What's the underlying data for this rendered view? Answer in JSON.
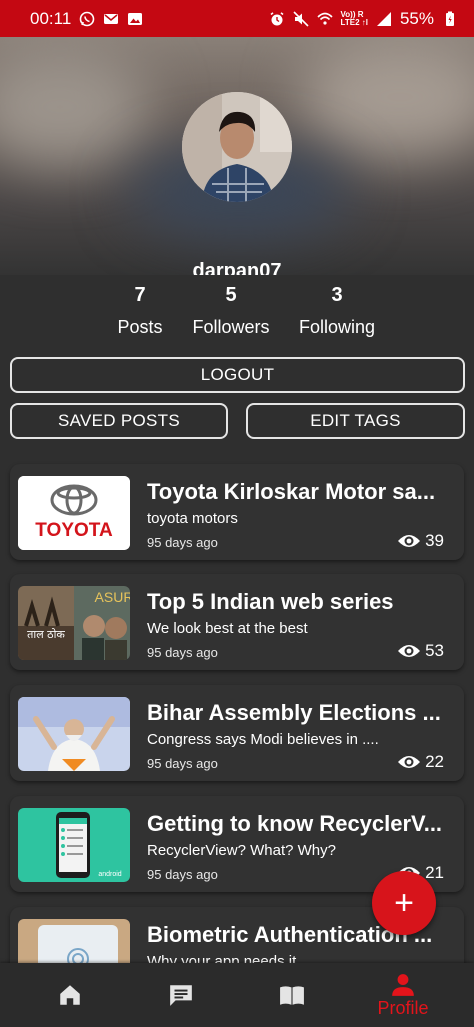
{
  "status_bar": {
    "time": "00:11",
    "network_label": "Vo)) R\nLTE2 ↑l",
    "battery": "55%",
    "colors": {
      "bar": "#c40812"
    }
  },
  "profile": {
    "username": "darpan07",
    "stats": [
      {
        "value": "7",
        "label": "Posts"
      },
      {
        "value": "5",
        "label": "Followers"
      },
      {
        "value": "3",
        "label": "Following"
      }
    ]
  },
  "buttons": {
    "logout": "LOGOUT",
    "saved_posts": "SAVED POSTS",
    "edit_tags": "EDIT TAGS"
  },
  "posts": [
    {
      "title": "Toyota Kirloskar Motor sa...",
      "subtitle": "toyota motors",
      "time": "95 days ago",
      "views": "39",
      "thumb_icon": "toyota-logo"
    },
    {
      "title": "Top 5 Indian web series",
      "subtitle": "We look best at the best",
      "time": "95 days ago",
      "views": "53",
      "thumb_icon": "web-series-poster"
    },
    {
      "title": "Bihar Assembly Elections ...",
      "subtitle": "Congress says Modi believes in ....",
      "time": "95 days ago",
      "views": "22",
      "thumb_icon": "politician-photo"
    },
    {
      "title": "Getting to know RecyclerV...",
      "subtitle": "RecyclerView? What? Why?",
      "time": "95 days ago",
      "views": "21",
      "thumb_icon": "android-phone"
    },
    {
      "title": "Biometric Authentication ...",
      "subtitle": "Why your app needs it",
      "time": "",
      "views": "",
      "thumb_icon": "fingerprint-phone"
    }
  ],
  "thumb_text": {
    "toyota": "TOYOTA",
    "asur": "ASUR",
    "taal_thok": "ताल ठोक",
    "android": "android"
  },
  "fab": {
    "label": "+"
  },
  "bottom_nav": {
    "items": [
      {
        "icon": "home-icon"
      },
      {
        "icon": "chat-icon"
      },
      {
        "icon": "book-icon"
      },
      {
        "icon": "person-icon",
        "label": "Profile"
      }
    ],
    "colors": {
      "active": "#e3141b",
      "inactive": "#e4e4e4"
    }
  }
}
